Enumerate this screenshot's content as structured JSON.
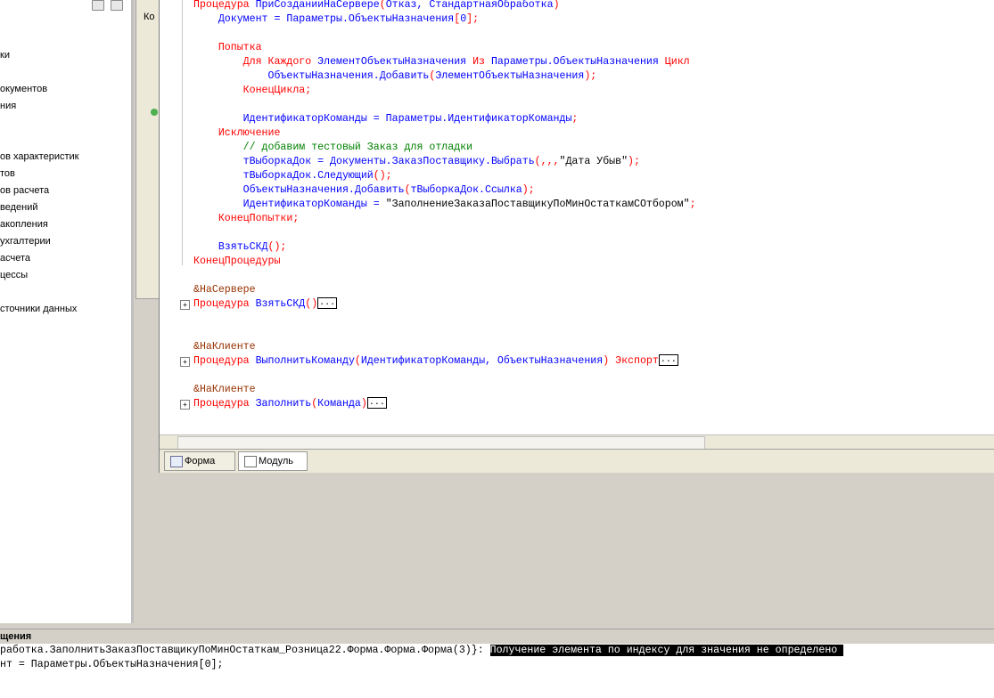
{
  "window": {
    "left_tree_items": [
      "ки",
      "",
      "окументов",
      "ния",
      "",
      "",
      "ов характеристик",
      "тов",
      "ов расчета",
      "ведений",
      "акопления",
      "ухгалтерии",
      "асчета",
      "цессы",
      "",
      "сточники данных"
    ],
    "form_panel_label": "Ко"
  },
  "code": {
    "lines": [
      [
        [
          "kw",
          "Процедура "
        ],
        [
          "id",
          "ПриСозданииНаСервере"
        ],
        [
          "kw",
          "("
        ],
        [
          "id",
          "Отказ, СтандартнаяОбработка"
        ],
        [
          "kw",
          ")"
        ]
      ],
      [
        [
          "id",
          "    Документ = Параметры.ОбъектыНазначения"
        ],
        [
          "kw",
          "["
        ],
        [
          "id",
          "0"
        ],
        [
          "kw",
          "];"
        ]
      ],
      [],
      [
        [
          "kw",
          "    Попытка"
        ]
      ],
      [
        [
          "kw",
          "        Для Каждого "
        ],
        [
          "id",
          "ЭлементОбъектыНазначения "
        ],
        [
          "kw",
          "Из "
        ],
        [
          "id",
          "Параметры.ОбъектыНазначения "
        ],
        [
          "kw",
          "Цикл"
        ]
      ],
      [
        [
          "id",
          "            ОбъектыНазначения.Добавить"
        ],
        [
          "kw",
          "("
        ],
        [
          "id",
          "ЭлементОбъектыНазначения"
        ],
        [
          "kw",
          ");"
        ]
      ],
      [
        [
          "kw",
          "        КонецЦикла;"
        ]
      ],
      [],
      [
        [
          "id",
          "        ИдентификаторКоманды = Параметры.ИдентификаторКоманды"
        ],
        [
          "kw",
          ";"
        ]
      ],
      [
        [
          "kw",
          "    Исключение"
        ]
      ],
      [
        [
          "cm",
          "        // добавим тестовый Заказ для отладки"
        ]
      ],
      [
        [
          "id",
          "        тВыборкаДок = Документы.ЗаказПоставщику.Выбрать"
        ],
        [
          "kw",
          "(,,,"
        ],
        [
          "str",
          "\"Дата Убыв\""
        ],
        [
          "kw",
          ");"
        ]
      ],
      [
        [
          "id",
          "        тВыборкаДок.Следующий"
        ],
        [
          "kw",
          "();"
        ]
      ],
      [
        [
          "id",
          "        ОбъектыНазначения.Добавить"
        ],
        [
          "kw",
          "("
        ],
        [
          "id",
          "тВыборкаДок.Ссылка"
        ],
        [
          "kw",
          ");"
        ]
      ],
      [
        [
          "id",
          "        ИдентификаторКоманды = "
        ],
        [
          "str",
          "\"ЗаполнениеЗаказаПоставщикуПоМинОстаткамСОтбором\""
        ],
        [
          "kw",
          ";"
        ]
      ],
      [
        [
          "kw",
          "    КонецПопытки;"
        ]
      ],
      [],
      [
        [
          "id",
          "    ВзятьСКД"
        ],
        [
          "kw",
          "();"
        ]
      ],
      [
        [
          "kw",
          "КонецПроцедуры"
        ]
      ],
      [],
      [
        [
          "pre",
          "&НаСервере"
        ]
      ],
      [
        [
          "kw",
          "Процедура "
        ],
        [
          "id",
          "ВзятьСКД"
        ],
        [
          "kw",
          "()"
        ],
        [
          "dots",
          "..."
        ]
      ],
      [],
      [],
      [
        [
          "pre",
          "&НаКлиенте"
        ]
      ],
      [
        [
          "kw",
          "Процедура "
        ],
        [
          "id",
          "ВыполнитьКоманду"
        ],
        [
          "kw",
          "("
        ],
        [
          "id",
          "ИдентификаторКоманды, ОбъектыНазначения"
        ],
        [
          "kw",
          ") Экспорт"
        ],
        [
          "dots",
          "..."
        ]
      ],
      [],
      [
        [
          "pre",
          "&НаКлиенте"
        ]
      ],
      [
        [
          "kw",
          "Процедура "
        ],
        [
          "id",
          "Заполнить"
        ],
        [
          "kw",
          "("
        ],
        [
          "id",
          "Команда"
        ],
        [
          "kw",
          ")"
        ],
        [
          "dots",
          "..."
        ]
      ]
    ]
  },
  "tabs": {
    "form": "Форма",
    "module": "Модуль"
  },
  "messages": {
    "header": "щения",
    "line1_prefix": "работка.ЗаполнитьЗаказПоставщикуПоМинОстаткам_Розница22.Форма.Форма.Форма(3)}: ",
    "line1_error": "Получение элемента по индексу для значения не определено ",
    "line2": "нт = Параметры.ОбъектыНазначения[0];"
  }
}
